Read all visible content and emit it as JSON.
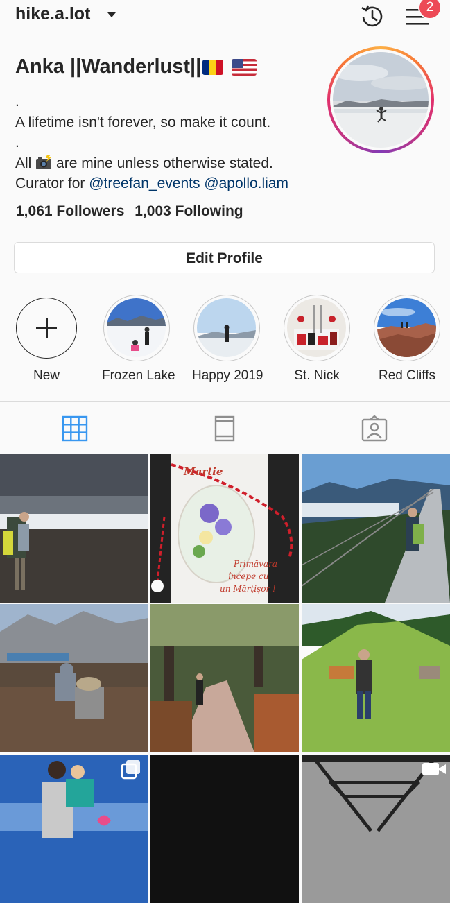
{
  "header": {
    "username": "hike.a.lot",
    "notification_count": "2",
    "icons": [
      "chevron-down-icon",
      "history-icon",
      "menu-icon"
    ]
  },
  "profile": {
    "display_name": "Anka ||Wanderlust||",
    "flags": [
      "romania-flag-icon",
      "usa-flag-icon"
    ],
    "bio": {
      "line1": ".",
      "line2": "A lifetime isn't forever, so make it count.",
      "line3": ".",
      "line4_prefix": "All",
      "line4_suffix": "are mine unless otherwise stated.",
      "line5_prefix": "Curator for",
      "mention1": "@treefan_events",
      "mention2": "@apollo.liam"
    },
    "followers": "1,061 Followers",
    "following": "1,003 Following",
    "edit_profile": "Edit Profile"
  },
  "highlights": [
    {
      "label": "New"
    },
    {
      "label": "Frozen Lake"
    },
    {
      "label": "Happy 2019"
    },
    {
      "label": "St. Nick"
    },
    {
      "label": "Red Cliffs"
    }
  ],
  "tabs": [
    "grid-icon",
    "feed-icon",
    "tagged-icon"
  ],
  "posts": {
    "post2_text": {
      "title": "Martie",
      "line1": "Primăvara",
      "line2": "începe cu",
      "line3": "un Mărțișor !"
    }
  },
  "colors": {
    "accent": "#3897f0",
    "badge": "#ed4956",
    "mention": "#003569",
    "text": "#262626"
  }
}
